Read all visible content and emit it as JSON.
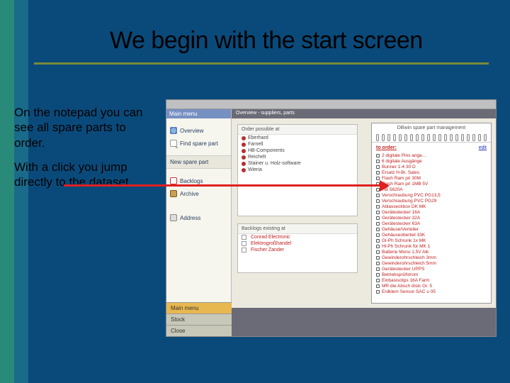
{
  "slide": {
    "title": "We begin with the start screen",
    "paragraph1": "On the notepad you can see all spare parts to order.",
    "paragraph2": "With a click you jump directly to the dataset"
  },
  "app": {
    "window_hint": "",
    "sidebar": {
      "header": "Main menu",
      "items": [
        {
          "label": "Overview",
          "icon": "overview-icon"
        },
        {
          "label": "Find spare part",
          "icon": "find-icon"
        },
        {
          "label": "New spare part",
          "icon": "new-icon",
          "style": "new"
        },
        {
          "label": "Backlogs",
          "icon": "backlog-icon"
        },
        {
          "label": "Archive",
          "icon": "archive-icon"
        },
        {
          "label": "Address",
          "icon": "address-icon"
        }
      ]
    },
    "content_header": "Overview - suppliers, parts",
    "suppliers_panel": {
      "title": "Order possible at",
      "items": [
        "Eberhard",
        "Farnell",
        "HB-Components",
        "Reichelt",
        "Stainer u. Holz-software",
        "Wieria"
      ]
    },
    "backlogs_panel": {
      "title": "Backlogs existing at",
      "items": [
        "Conrad Electronic",
        "Elektrogroßhandel",
        "Fischer Zander"
      ]
    },
    "bottom_nav": [
      "Main menu",
      "Stock",
      "Close"
    ]
  },
  "notepad": {
    "title": "DBwin spare part management",
    "header_label": "to order:",
    "edit_label": "edit",
    "items": [
      "2 digitale Pins ange...",
      "6 digitale Ausgänge",
      "Bunner 1-4 30 D",
      "Ersatz H-Br. Sales",
      "Flash Ram pri 30M",
      "Flash Ram pri 1MB 5V",
      "HB 5620A",
      "Verschraubung PVC PG13,5",
      "Verschraubung PVC PG29",
      "Ablasseckbox DK MK",
      "Gerätestecker 16A",
      "Gerätestecker 32A",
      "Gerätestecker 63A",
      "Gehäuse/Verteiler",
      "Gehäuseoberteil 33K",
      "Gl-Ph Schrunk 1x MK",
      "Hl-Ph Schrunk für MK 1",
      "Batterie Mono 1,5V Alk",
      "Gewinderohrschleich 3mm",
      "Gewinderohrschleich 5mm",
      "Gerätestecker UPPS",
      "Betriebsprüfstrom",
      "Einbasisclips 16A Farm",
      "MR die Absch distc Gr. 5",
      "Erdklem Sensor SAC u 05"
    ]
  }
}
